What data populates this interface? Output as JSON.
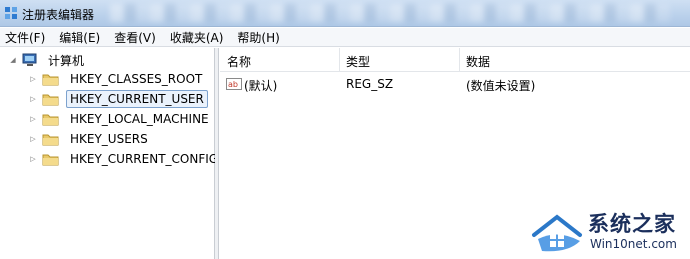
{
  "window": {
    "title": "注册表编辑器"
  },
  "menu": [
    "文件(F)",
    "编辑(E)",
    "查看(V)",
    "收藏夹(A)",
    "帮助(H)"
  ],
  "tree": {
    "root": "计算机",
    "keys": [
      "HKEY_CLASSES_ROOT",
      "HKEY_CURRENT_USER",
      "HKEY_LOCAL_MACHINE",
      "HKEY_USERS",
      "HKEY_CURRENT_CONFIG"
    ],
    "selected": "HKEY_CURRENT_USER"
  },
  "list": {
    "columns": [
      "名称",
      "类型",
      "数据"
    ],
    "rows": [
      {
        "name": "(默认)",
        "type": "REG_SZ",
        "data": "(数值未设置)"
      }
    ]
  },
  "watermark": {
    "brand": "系统之家",
    "site": "Win10net.com"
  },
  "icons": {
    "app": "registry-editor-icon",
    "root": "computer-icon",
    "key": "folder-icon",
    "value": "string-value-icon"
  },
  "colors": {
    "titlebar": "#bcd2ec",
    "selection_border": "#7da2ce",
    "folder": "#e8c86a",
    "watermark": "#1b2f5c"
  }
}
